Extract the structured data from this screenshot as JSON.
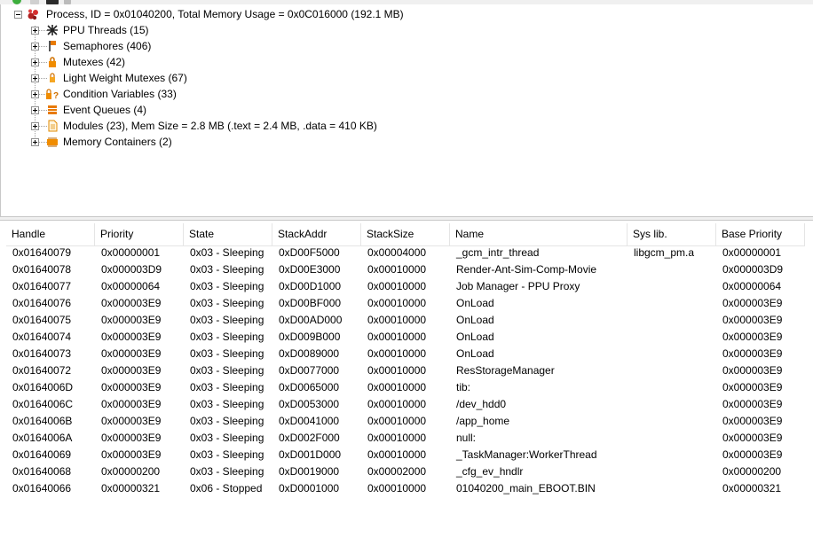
{
  "tree": {
    "root": {
      "label": "Process, ID = 0x01040200, Total Memory Usage = 0x0C016000 (192.1 MB)",
      "icon": "process-icon"
    },
    "children": [
      {
        "label": "PPU Threads (15)",
        "icon": "threads-icon"
      },
      {
        "label": "Semaphores (406)",
        "icon": "semaphore-icon"
      },
      {
        "label": "Mutexes (42)",
        "icon": "mutex-lock-icon"
      },
      {
        "label": "Light Weight Mutexes (67)",
        "icon": "lw-mutex-lock-icon"
      },
      {
        "label": "Condition Variables (33)",
        "icon": "condition-variable-icon"
      },
      {
        "label": "Event Queues (4)",
        "icon": "event-queue-icon"
      },
      {
        "label": "Modules (23), Mem Size = 2.8 MB (.text = 2.4 MB, .data = 410 KB)",
        "icon": "module-page-icon"
      },
      {
        "label": "Memory Containers (2)",
        "icon": "memory-container-icon"
      }
    ]
  },
  "table": {
    "columns": [
      "Handle",
      "Priority",
      "State",
      "StackAddr",
      "StackSize",
      "Name",
      "Sys lib.",
      "Base Priority"
    ],
    "rows": [
      [
        "0x01640079",
        "0x00000001",
        "0x03 - Sleeping",
        "0xD00F5000",
        "0x00004000",
        "_gcm_intr_thread",
        "libgcm_pm.a",
        "0x00000001"
      ],
      [
        "0x01640078",
        "0x000003D9",
        "0x03 - Sleeping",
        "0xD00E3000",
        "0x00010000",
        "Render-Ant-Sim-Comp-Movie",
        "",
        "0x000003D9"
      ],
      [
        "0x01640077",
        "0x00000064",
        "0x03 - Sleeping",
        "0xD00D1000",
        "0x00010000",
        "Job Manager - PPU Proxy",
        "",
        "0x00000064"
      ],
      [
        "0x01640076",
        "0x000003E9",
        "0x03 - Sleeping",
        "0xD00BF000",
        "0x00010000",
        "OnLoad",
        "",
        "0x000003E9"
      ],
      [
        "0x01640075",
        "0x000003E9",
        "0x03 - Sleeping",
        "0xD00AD000",
        "0x00010000",
        "OnLoad",
        "",
        "0x000003E9"
      ],
      [
        "0x01640074",
        "0x000003E9",
        "0x03 - Sleeping",
        "0xD009B000",
        "0x00010000",
        "OnLoad",
        "",
        "0x000003E9"
      ],
      [
        "0x01640073",
        "0x000003E9",
        "0x03 - Sleeping",
        "0xD0089000",
        "0x00010000",
        "OnLoad",
        "",
        "0x000003E9"
      ],
      [
        "0x01640072",
        "0x000003E9",
        "0x03 - Sleeping",
        "0xD0077000",
        "0x00010000",
        "ResStorageManager",
        "",
        "0x000003E9"
      ],
      [
        "0x0164006D",
        "0x000003E9",
        "0x03 - Sleeping",
        "0xD0065000",
        "0x00010000",
        "tib:",
        "",
        "0x000003E9"
      ],
      [
        "0x0164006C",
        "0x000003E9",
        "0x03 - Sleeping",
        "0xD0053000",
        "0x00010000",
        "/dev_hdd0",
        "",
        "0x000003E9"
      ],
      [
        "0x0164006B",
        "0x000003E9",
        "0x03 - Sleeping",
        "0xD0041000",
        "0x00010000",
        "/app_home",
        "",
        "0x000003E9"
      ],
      [
        "0x0164006A",
        "0x000003E9",
        "0x03 - Sleeping",
        "0xD002F000",
        "0x00010000",
        "null:",
        "",
        "0x000003E9"
      ],
      [
        "0x01640069",
        "0x000003E9",
        "0x03 - Sleeping",
        "0xD001D000",
        "0x00010000",
        "_TaskManager:WorkerThread",
        "",
        "0x000003E9"
      ],
      [
        "0x01640068",
        "0x00000200",
        "0x03 - Sleeping",
        "0xD0019000",
        "0x00002000",
        "_cfg_ev_hndlr",
        "",
        "0x00000200"
      ],
      [
        "0x01640066",
        "0x00000321",
        "0x06 - Stopped",
        "0xD0001000",
        "0x00010000",
        "01040200_main_EBOOT.BIN",
        "",
        "0x00000321"
      ]
    ]
  }
}
